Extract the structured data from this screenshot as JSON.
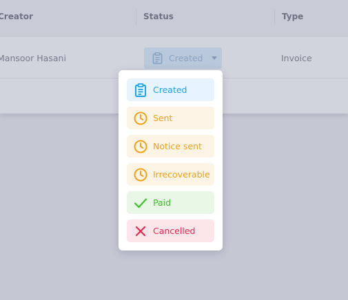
{
  "table": {
    "headers": [
      {
        "label": "Creator"
      },
      {
        "label": "Status"
      },
      {
        "label": "Type"
      }
    ],
    "rows": [
      {
        "creator": "Mansoor Hasani",
        "status": "Created",
        "type": "Invoice"
      }
    ]
  },
  "status_select": {
    "value": "Created",
    "icon": "clipboard-icon"
  },
  "dropdown": {
    "options": [
      {
        "label": "Created",
        "icon": "clipboard-icon",
        "color": "#1aa3e8",
        "bg": "#e8f4fd"
      },
      {
        "label": "Sent",
        "icon": "clock-icon",
        "color": "#f0a21a",
        "bg": "#fdf4e6"
      },
      {
        "label": "Notice sent",
        "icon": "clock-icon",
        "color": "#f0a21a",
        "bg": "#fdf4e6"
      },
      {
        "label": "Irrecoverable",
        "icon": "clock-icon",
        "color": "#f0a21a",
        "bg": "#fdf4e6"
      },
      {
        "label": "Paid",
        "icon": "check-icon",
        "color": "#3fbf2c",
        "bg": "#e9f8e6"
      },
      {
        "label": "Cancelled",
        "icon": "x-icon",
        "color": "#e8284c",
        "bg": "#fde6ea"
      }
    ]
  }
}
